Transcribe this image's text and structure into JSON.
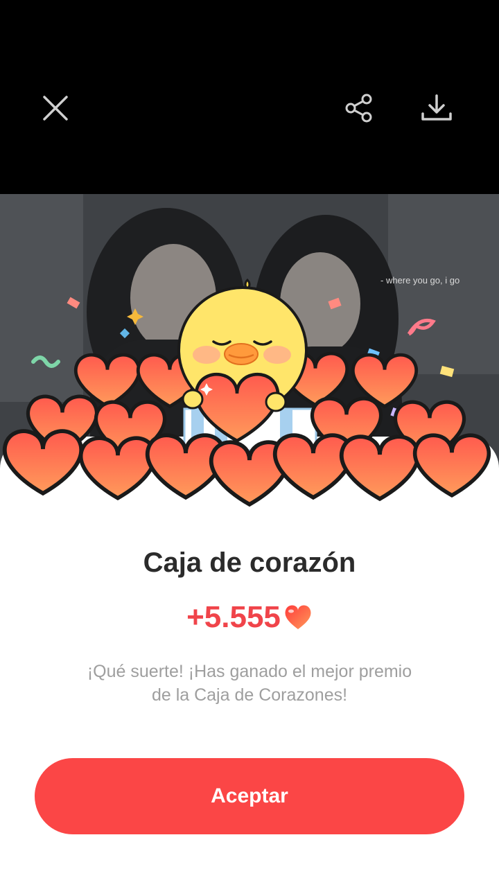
{
  "topbar": {
    "close_icon": "close-icon",
    "share_icon": "share-icon",
    "download_icon": "download-icon"
  },
  "photo": {
    "caption": "- where you go, i go"
  },
  "reward": {
    "title": "Caja de corazón",
    "amount": "+5.555",
    "amount_icon": "heart-icon",
    "description": "¡Qué suerte! ¡Has ganado el mejor premio de la Caja de Corazones!",
    "accept_label": "Aceptar"
  },
  "colors": {
    "accent": "#fb4646",
    "amount": "#f0444a",
    "title": "#2b2b2b",
    "description": "#9e9e9e"
  }
}
